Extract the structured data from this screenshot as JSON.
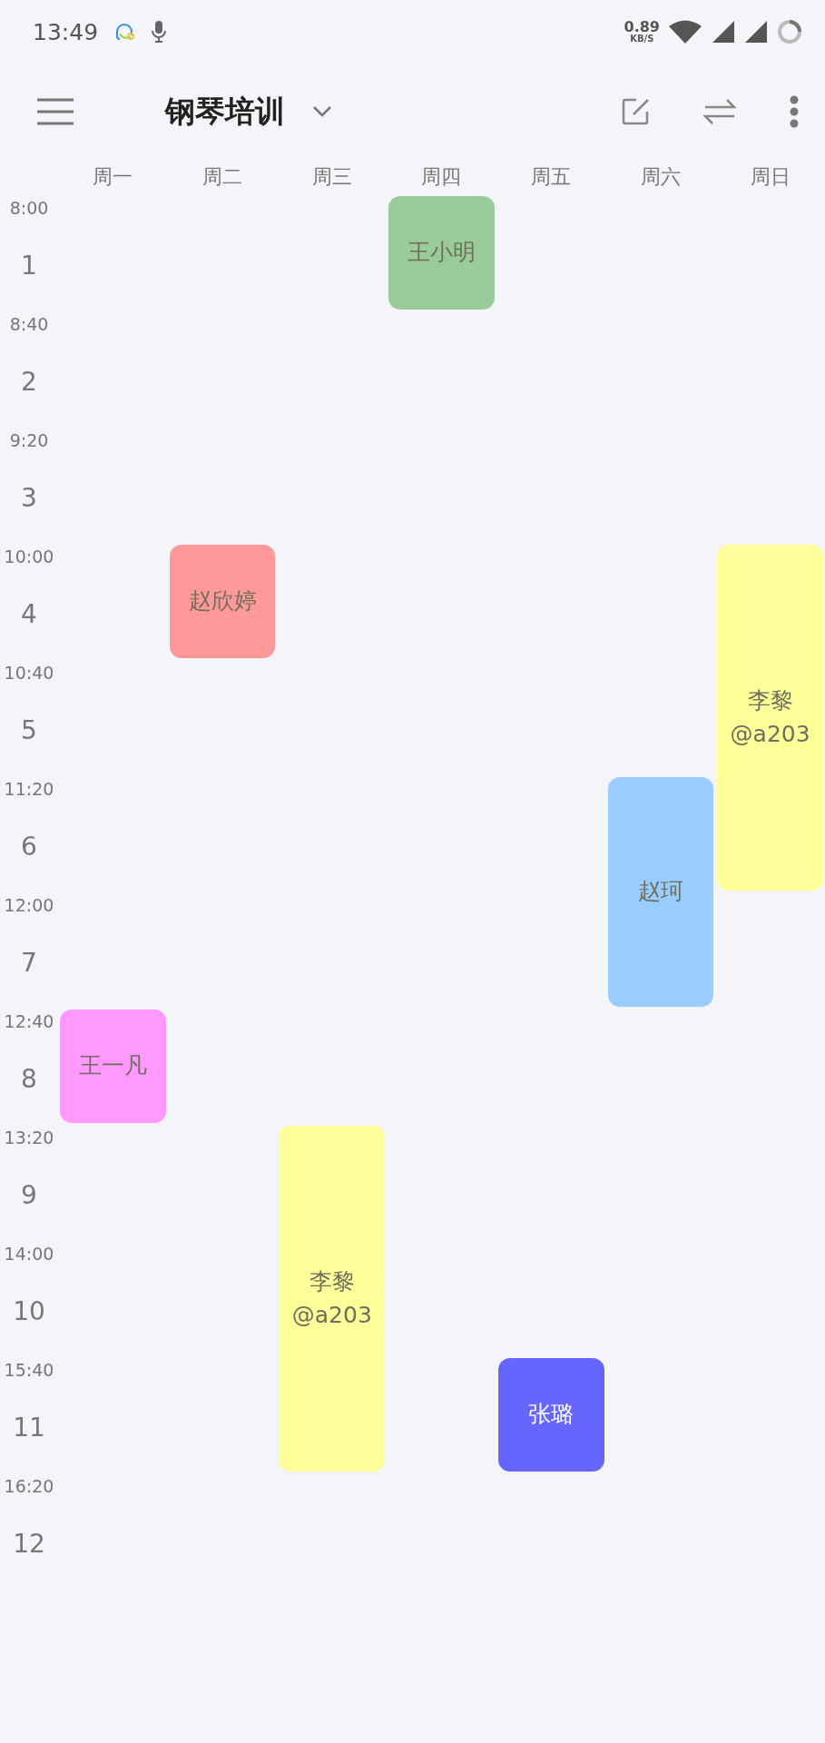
{
  "status_bar": {
    "time": "13:49",
    "net_speed": "0.89",
    "net_unit": "KB/S"
  },
  "toolbar": {
    "title": "钢琴培训"
  },
  "periods": [
    {
      "time": "8:00",
      "number": "1"
    },
    {
      "time": "8:40",
      "number": "2"
    },
    {
      "time": "9:20",
      "number": "3"
    },
    {
      "time": "10:00",
      "number": "4"
    },
    {
      "time": "10:40",
      "number": "5"
    },
    {
      "time": "11:20",
      "number": "6"
    },
    {
      "time": "12:00",
      "number": "7"
    },
    {
      "time": "12:40",
      "number": "8"
    },
    {
      "time": "13:20",
      "number": "9"
    },
    {
      "time": "14:00",
      "number": "10"
    },
    {
      "time": "15:40",
      "number": "11"
    },
    {
      "time": "16:20",
      "number": "12"
    }
  ],
  "days": [
    {
      "label": "周一",
      "cells": [
        {
          "kind": "empty"
        },
        {
          "kind": "empty"
        },
        {
          "kind": "empty"
        },
        {
          "kind": "empty"
        },
        {
          "kind": "empty"
        },
        {
          "kind": "empty"
        },
        {
          "kind": "empty"
        },
        {
          "kind": "course",
          "name": "王一凡",
          "color": "#ff99ff"
        },
        {
          "kind": "empty"
        },
        {
          "kind": "empty"
        },
        {
          "kind": "empty"
        },
        {
          "kind": "empty"
        }
      ]
    },
    {
      "label": "周二",
      "cells": [
        {
          "kind": "empty"
        },
        {
          "kind": "empty"
        },
        {
          "kind": "empty"
        },
        {
          "kind": "course",
          "name": "赵欣婷",
          "color": "#ff9999"
        },
        {
          "kind": "empty"
        },
        {
          "kind": "empty"
        },
        {
          "kind": "empty"
        },
        {
          "kind": "empty"
        },
        {
          "kind": "empty"
        },
        {
          "kind": "empty"
        },
        {
          "kind": "empty"
        },
        {
          "kind": "empty"
        }
      ]
    },
    {
      "label": "周三",
      "cells": [
        {
          "kind": "empty"
        },
        {
          "kind": "empty"
        },
        {
          "kind": "empty"
        },
        {
          "kind": "empty"
        },
        {
          "kind": "empty"
        },
        {
          "kind": "empty"
        },
        {
          "kind": "empty"
        },
        {
          "kind": "empty"
        },
        {
          "kind": "course",
          "name": "李黎",
          "room": "@a203",
          "color": "#ffff99"
        },
        {
          "kind": "continued"
        },
        {
          "kind": "continued"
        },
        {
          "kind": "empty"
        }
      ]
    },
    {
      "label": "周四",
      "cells": [
        {
          "kind": "course",
          "name": "王小明",
          "color": "#99cc99"
        },
        {
          "kind": "empty"
        },
        {
          "kind": "empty"
        },
        {
          "kind": "empty"
        },
        {
          "kind": "empty"
        },
        {
          "kind": "empty"
        },
        {
          "kind": "empty"
        },
        {
          "kind": "empty"
        },
        {
          "kind": "empty"
        },
        {
          "kind": "empty"
        },
        {
          "kind": "empty"
        },
        {
          "kind": "empty"
        }
      ]
    },
    {
      "label": "周五",
      "cells": [
        {
          "kind": "empty"
        },
        {
          "kind": "empty"
        },
        {
          "kind": "empty"
        },
        {
          "kind": "empty"
        },
        {
          "kind": "empty"
        },
        {
          "kind": "empty"
        },
        {
          "kind": "empty"
        },
        {
          "kind": "empty"
        },
        {
          "kind": "empty"
        },
        {
          "kind": "empty"
        },
        {
          "kind": "course",
          "name": "张璐",
          "color": "#6666ff"
        },
        {
          "kind": "empty"
        }
      ]
    },
    {
      "label": "周六",
      "cells": [
        {
          "kind": "empty"
        },
        {
          "kind": "empty"
        },
        {
          "kind": "empty"
        },
        {
          "kind": "empty"
        },
        {
          "kind": "empty"
        },
        {
          "kind": "course",
          "name": "赵珂",
          "color": "#99ccff"
        },
        {
          "kind": "continued"
        },
        {
          "kind": "empty"
        },
        {
          "kind": "empty"
        },
        {
          "kind": "empty"
        },
        {
          "kind": "empty"
        },
        {
          "kind": "empty"
        }
      ]
    },
    {
      "label": "周日",
      "cells": [
        {
          "kind": "empty"
        },
        {
          "kind": "empty"
        },
        {
          "kind": "empty"
        },
        {
          "kind": "course",
          "name": "李黎",
          "room": "@a203",
          "color": "#ffff99"
        },
        {
          "kind": "continued"
        },
        {
          "kind": "continued"
        },
        {
          "kind": "empty"
        },
        {
          "kind": "empty"
        },
        {
          "kind": "empty"
        },
        {
          "kind": "empty"
        },
        {
          "kind": "empty"
        },
        {
          "kind": "empty"
        }
      ]
    }
  ]
}
